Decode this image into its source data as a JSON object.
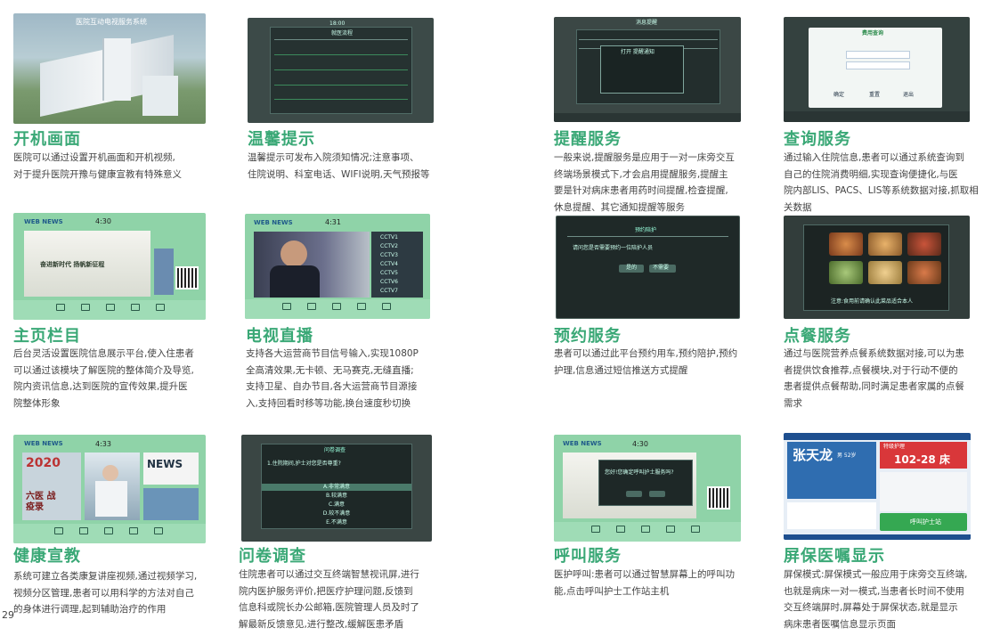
{
  "page_number": "29",
  "features": [
    {
      "title": "开机画面",
      "desc": [
        "医院可以通过设置开机画面和开机视频,",
        "对于提升医院开豫与健康宣教有特殊意义"
      ],
      "screen_text": "医院互动电视服务系统"
    },
    {
      "title": "温馨提示",
      "desc": [
        "温馨提示可发布入院须知情况;注意事项、",
        "住院说明、科室电话、WIFI说明,天气预报等"
      ],
      "screen_text": "就医流程",
      "time": "18:00"
    },
    {
      "title": "提醒服务",
      "desc": [
        "一般来说,提醒服务是应用于一对一床旁交互",
        "终端场景模式下,才会启用提醒服务,提醒主",
        "要是针对病床患者用药时间提醒,检查提醒,",
        "休息提醒、其它通知提醒等服务"
      ],
      "screen_text": "消息提醒",
      "popup": "打开 提醒通知"
    },
    {
      "title": "查询服务",
      "desc": [
        "通过输入住院信息,患者可以通过系统查询到",
        "自己的住院消费明细,实现查询便捷化,与医",
        "院内部LIS、PACS、LIS等系统数据对接,抓取相",
        "关数据"
      ],
      "screen_text": "费用查询",
      "form_labels": [
        "确定",
        "重置",
        "退出"
      ]
    },
    {
      "title": "主页栏目",
      "desc": [
        "后台灵活设置医院信息展示平台,使入住患者",
        "可以通过该模块了解医院的整体简介及导览,",
        "院内资讯信息,达到医院的宣传效果,提升医",
        "院整体形象"
      ],
      "logo": "WEB NEWS",
      "time": "4:30",
      "banner": "奋进新时代 扬帆新征程"
    },
    {
      "title": "电视直播",
      "desc": [
        "支持各大运营商节目信号输入,实现1080P",
        "全高清效果,无卡顿、无马赛克,无缝直播;",
        "支持卫星、自办节目,各大运营商节目源接",
        "入,支持回看时移等功能,换台速度秒切换"
      ],
      "logo": "WEB NEWS",
      "time": "4:31",
      "channels": [
        "CCTV1",
        "CCTV2",
        "CCTV3",
        "CCTV4",
        "CCTV5",
        "CCTV6",
        "CCTV7"
      ]
    },
    {
      "title": "预约服务",
      "desc": [
        "患者可以通过此平台预约用车,预约陪护,预约",
        "护理,信息通过短信推送方式提醒"
      ],
      "screen_text": "预约陪护",
      "popup": "请问您是否需要预约一位陪护人员",
      "buttons": [
        "是的",
        "不需要"
      ]
    },
    {
      "title": "点餐服务",
      "desc": [
        "通过与医院营养点餐系统数据对接,可以为患",
        "者提供饮食推荐,点餐模块,对于行动不便的",
        "患者提供点餐帮助,同时满足患者家属的点餐",
        "需求"
      ],
      "screen_text": "注意:食用前请确认此菜品适合本人"
    },
    {
      "title": "健康宣教",
      "desc": [
        "系统可建立各类康复讲座视频,通过视频学习,",
        "视频分区管理,患者可以用科学的方法对自己",
        "的身体进行调理,起到辅助治疗的作用"
      ],
      "logo": "WEB NEWS",
      "time": "4:33",
      "tiles": [
        "2020",
        "六医 战疫录",
        "NEWS"
      ]
    },
    {
      "title": "问卷调查",
      "desc": [
        "住院患者可以通过交互终端智慧视讯屏,进行",
        "院内医护服务评价,把医疗护理问题,反馈到",
        "信息科或院长办公邮箱,医院管理人员及时了",
        "解最新反馈意见,进行整改,缓解医患矛盾"
      ],
      "screen_text": "问卷调查",
      "question": "1.住院期间,护士对您是否尊重?",
      "options": [
        "A.非常满意",
        "B.较满意",
        "C.满意",
        "D.较不满意",
        "E.不满意"
      ]
    },
    {
      "title": "呼叫服务",
      "desc": [
        "医护呼叫:患者可以通过智慧屏幕上的呼叫功",
        "能,点击呼叫护士工作站主机"
      ],
      "logo": "WEB NEWS",
      "time": "4:30",
      "popup": "您好!您确定呼叫护士服务吗?"
    },
    {
      "title": "屏保医嘱显示",
      "desc": [
        "屏保模式:屏保模式一般应用于床旁交互终端,",
        "也就是病床一对一模式,当患者长时间不使用",
        "交互终端屏时,屏幕处于屏保状态,就是显示",
        "病床患者医嘱信息显示页面"
      ],
      "patient_name": "张天龙",
      "patient_info": "男 52岁",
      "bed_label": "特级护理",
      "bed": "102-28 床",
      "call_button": "呼叫护士站"
    }
  ],
  "colors": {
    "title": "#3aa876",
    "mint": "#8fd3a8",
    "dark": "#2d3a38",
    "blue": "#2f6db0",
    "red": "#d9373a",
    "green_btn": "#35a852"
  }
}
